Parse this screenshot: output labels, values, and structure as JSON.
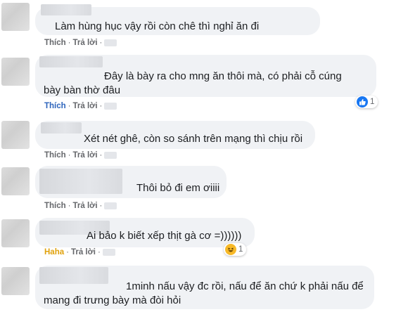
{
  "comments": [
    {
      "text": "Làm hùng hục vậy rồi còn chê thì nghỉ ăn đi",
      "actions": {
        "like": "Thích",
        "reply": "Trả lời",
        "sep": "·"
      }
    },
    {
      "text_line1": "Đây là bày ra cho mng ăn thôi mà, có phải cỗ cúng",
      "text_line2": "bày bàn thờ đâu",
      "actions": {
        "like": "Thích",
        "reply": "Trả lời",
        "sep": "·"
      },
      "reaction": {
        "icon": "like-icon",
        "count": "1",
        "color": "#1877f2"
      }
    },
    {
      "text": "Xét nét ghê, còn so sánh trên mạng thì chịu rồi",
      "actions": {
        "like": "Thích",
        "reply": "Trả lời",
        "sep": "·"
      }
    },
    {
      "text": "Thôi bỏ đi em ơiiii",
      "actions": {
        "like": "Thích",
        "reply": "Trả lời",
        "sep": "·"
      }
    },
    {
      "text": "Ai bảo k biết xếp thịt gà cơ =))))))",
      "actions": {
        "like": "Haha",
        "reply": "Trả lời",
        "sep": "·"
      },
      "reaction": {
        "icon": "haha-icon",
        "count": "1",
        "color": "#f7b928"
      }
    },
    {
      "text_line1": "1minh nấu vậy đc rồi, nấu để ăn chứ k phải nấu để",
      "text_line2": "mang đi trưng bày mà đòi hỏi"
    }
  ],
  "colors": {
    "bubble": "#f0f2f5",
    "liked": "#2d64bc",
    "haha": "#e0a10b",
    "meta": "#65676b"
  }
}
